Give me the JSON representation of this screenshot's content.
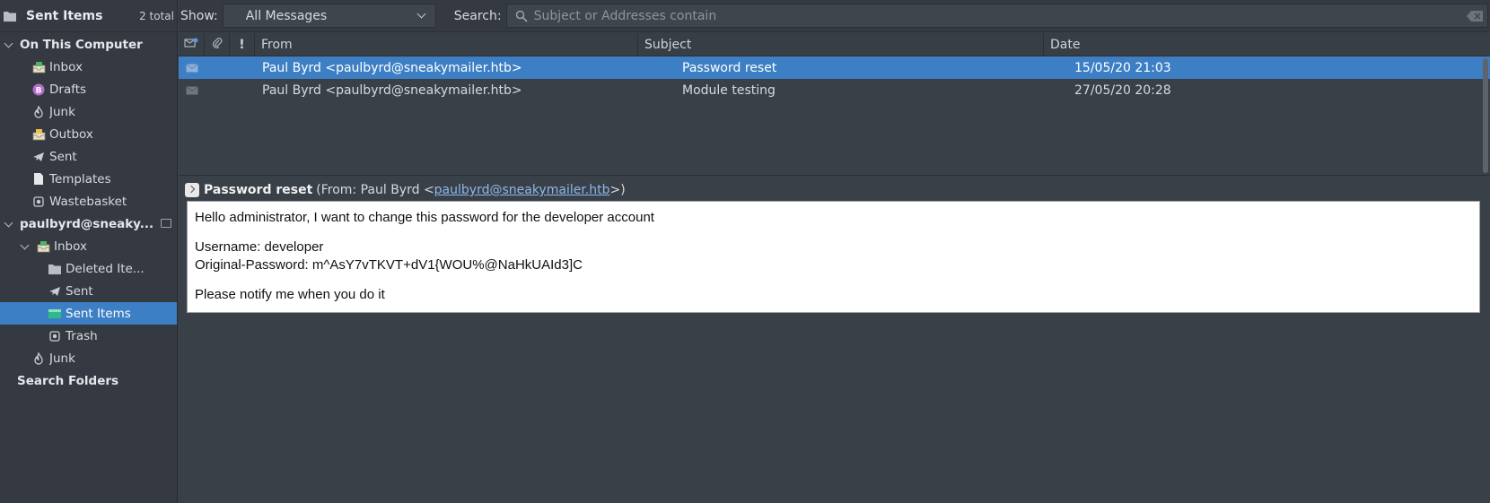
{
  "sidebar": {
    "header_title": "Sent Items",
    "header_count": "2 total",
    "groups": {
      "on_this_computer": "On This Computer",
      "account": "paulbyrd@sneaky...",
      "search_folders": "Search Folders"
    },
    "local_folders": {
      "inbox": "Inbox",
      "drafts": "Drafts",
      "junk": "Junk",
      "outbox": "Outbox",
      "sent": "Sent",
      "templates": "Templates",
      "wastebasket": "Wastebasket"
    },
    "account_folders": {
      "inbox": "Inbox",
      "deleted": "Deleted Ite...",
      "sent": "Sent",
      "sent_items": "Sent Items",
      "trash": "Trash",
      "junk": "Junk"
    },
    "selected": "Sent Items"
  },
  "toolbar": {
    "show_label": "Show:",
    "show_value": "All Messages",
    "search_label": "Search:",
    "search_placeholder": "Subject or Addresses contain",
    "search_value": ""
  },
  "list": {
    "columns": {
      "flag": "!",
      "from": "From",
      "subject": "Subject",
      "date": "Date"
    },
    "rows": [
      {
        "from": "Paul Byrd <paulbyrd@sneakymailer.htb>",
        "subject": "Password reset",
        "date": "15/05/20 21:03",
        "selected": true
      },
      {
        "from": "Paul Byrd <paulbyrd@sneakymailer.htb>",
        "subject": "Module testing",
        "date": "27/05/20 20:28",
        "selected": false
      }
    ]
  },
  "preview": {
    "subject": "Password reset",
    "from_prefix": "(From: Paul Byrd <",
    "from_email": "paulbyrd@sneakymailer.htb",
    "from_suffix": ">)",
    "body_lines": {
      "line1": "Hello administrator, I want to change this password for the developer account",
      "line2": "Username: developer",
      "line3": "Original-Password: m^AsY7vTKVT+dV1{WOU%@NaHkUAId3]C",
      "line4": "Please notify me when you do it"
    }
  },
  "colors": {
    "selection": "#3d7fc4",
    "background": "#3a4048",
    "sidebar": "#353a42",
    "link": "#8cb8ec"
  }
}
